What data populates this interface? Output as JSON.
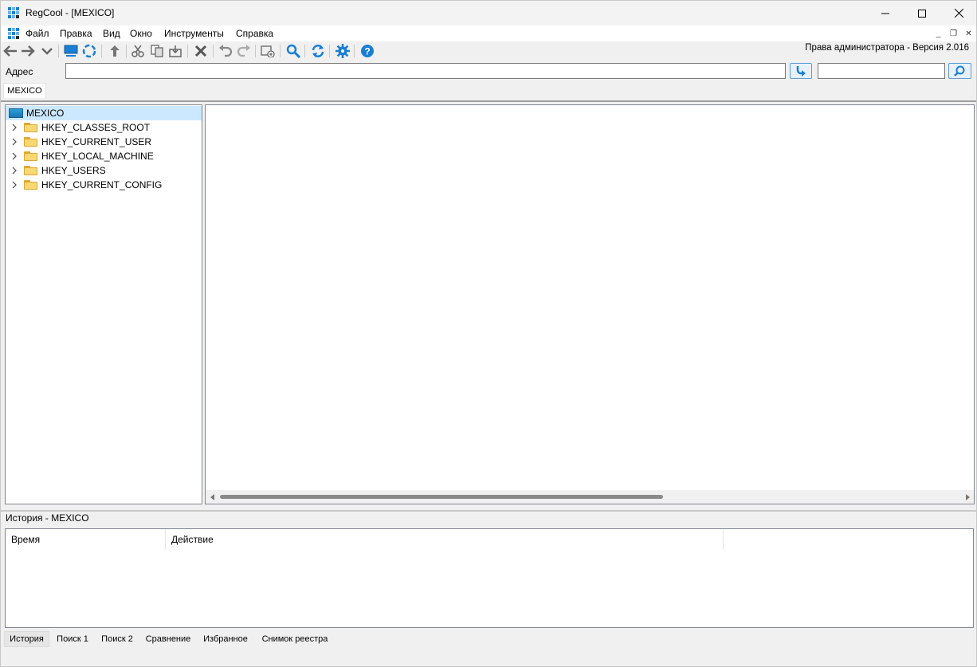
{
  "window": {
    "title": "RegCool - [MEXICO]"
  },
  "menubar": {
    "items": [
      "Файл",
      "Правка",
      "Вид",
      "Окно",
      "Инструменты",
      "Справка"
    ]
  },
  "toolbar": {
    "status_text": "Права администратора - Версия 2.016",
    "buttons": [
      "back-icon",
      "forward-icon",
      "dropdown-icon",
      "computer-icon",
      "network-icon",
      "up-icon",
      "cut-icon",
      "copy-icon",
      "export-icon",
      "delete-icon",
      "undo-icon",
      "redo-icon",
      "new-key-icon",
      "search-icon",
      "refresh-icon",
      "settings-icon",
      "help-icon"
    ]
  },
  "address": {
    "label": "Адрес",
    "value": "",
    "search_value": ""
  },
  "document_tab": {
    "label": "MEXICO"
  },
  "tree": {
    "root": "MEXICO",
    "items": [
      "HKEY_CLASSES_ROOT",
      "HKEY_CURRENT_USER",
      "HKEY_LOCAL_MACHINE",
      "HKEY_USERS",
      "HKEY_CURRENT_CONFIG"
    ]
  },
  "history": {
    "title": "История - MEXICO",
    "columns": [
      "Время",
      "Действие",
      ""
    ]
  },
  "bottom_tabs": [
    "История",
    "Поиск 1",
    "Поиск 2",
    "Сравнение",
    "Избранное",
    "Снимок реестра"
  ],
  "colors": {
    "accent": "#1a7fd4",
    "selection": "#cce8ff",
    "folder": "#f8d775"
  }
}
